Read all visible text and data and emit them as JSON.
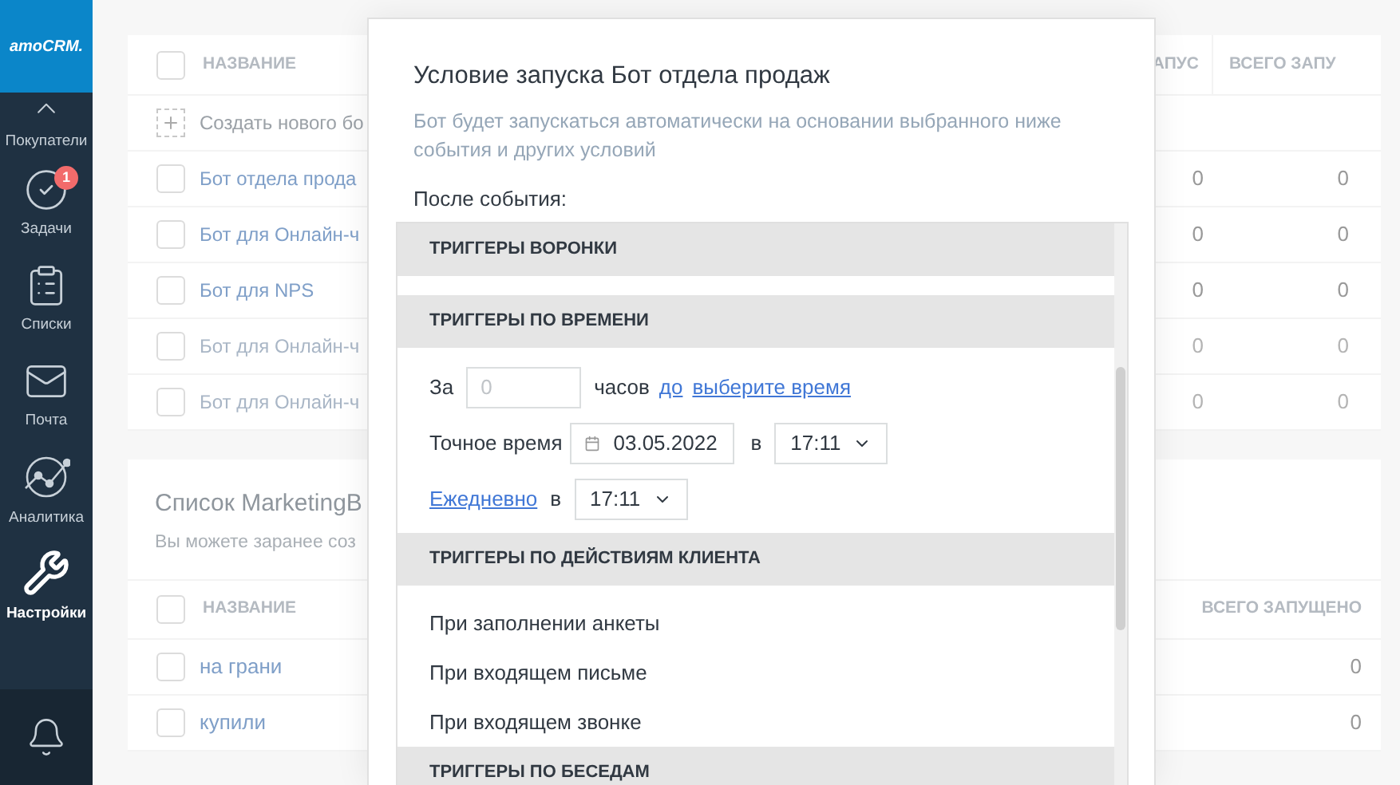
{
  "logo": "amoCRM.",
  "sidebar": {
    "items": [
      {
        "kind": "customers",
        "label": "Покупатели",
        "selected": false
      },
      {
        "kind": "tasks",
        "label": "Задачи",
        "selected": false,
        "badge": "1"
      },
      {
        "kind": "lists",
        "label": "Списки",
        "selected": false
      },
      {
        "kind": "mail",
        "label": "Почта",
        "selected": false
      },
      {
        "kind": "analytics",
        "label": "Аналитика",
        "selected": false
      },
      {
        "kind": "settings",
        "label": "Настройки",
        "selected": true
      }
    ]
  },
  "bots_table": {
    "columns": [
      "НАЗВАНИЕ",
      "АПУС",
      "ВСЕГО ЗАПУ"
    ],
    "header_checked": false,
    "create_label": "Создать нового бо",
    "rows": [
      {
        "name": "Бот отдела прода",
        "column_2": "0",
        "column_3": "0",
        "disabled": false,
        "checked": false
      },
      {
        "name": "Бот для Онлайн-ч",
        "column_2": "0",
        "column_3": "0",
        "disabled": false,
        "checked": false
      },
      {
        "name": "Бот для NPS",
        "column_2": "0",
        "column_3": "0",
        "disabled": false,
        "checked": false
      },
      {
        "name": "Бот для Онлайн-ч",
        "column_2": "0",
        "column_3": "0",
        "disabled": true,
        "checked": false
      },
      {
        "name": "Бот для Онлайн-ч",
        "column_2": "0",
        "column_3": "0",
        "disabled": true,
        "checked": false
      }
    ]
  },
  "marketing": {
    "title": "Список MarketingB",
    "subtitle": "Вы можете заранее соз",
    "columns": [
      "НАЗВАНИЕ",
      "ВСЕГО ЗАПУЩЕНО"
    ],
    "header_checked": false,
    "rows": [
      {
        "name": "на грани",
        "total": "0",
        "checked": false
      },
      {
        "name": "купили",
        "total": "0",
        "checked": false
      }
    ]
  },
  "modal": {
    "title": "Условие запуска Бот отдела продаж",
    "description": "Бот будет запускаться автоматически на основании выбранного ниже события и других условий",
    "event_label": "После события:",
    "sections": [
      {
        "kind": "empty",
        "title": "ТРИГГЕРЫ ВОРОНКИ"
      },
      {
        "kind": "time",
        "title": "ТРИГГЕРЫ ПО ВРЕМЕНИ",
        "before": {
          "prefix": "За",
          "placeholder": "0",
          "unit": "часов",
          "direction": "до",
          "time_link": "выберите время"
        },
        "exact": {
          "label": "Точное время",
          "date": "03.05.2022",
          "at": "в",
          "time": "17:11"
        },
        "daily": {
          "link": "Ежедневно",
          "at": "в",
          "time": "17:11"
        }
      },
      {
        "kind": "list",
        "title": "ТРИГГЕРЫ ПО ДЕЙСТВИЯМ КЛИЕНТА",
        "items": [
          "При заполнении анкеты",
          "При входящем письме",
          "При входящем звонке"
        ]
      },
      {
        "kind": "list",
        "title": "ТРИГГЕРЫ ПО БЕСЕДАМ"
      }
    ]
  }
}
